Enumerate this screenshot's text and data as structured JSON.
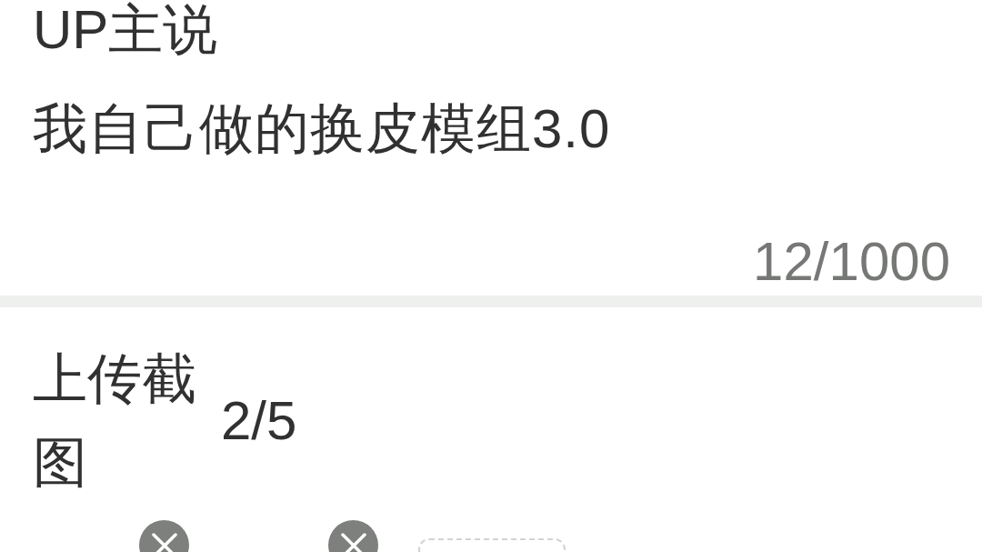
{
  "description_section": {
    "title": "UP主说",
    "value": "我自己做的换皮模组3.0",
    "counter": "12/1000"
  },
  "screenshots_section": {
    "label": "上传截图",
    "count": "2/5",
    "items": [
      {
        "kind": "screenshot"
      },
      {
        "kind": "screenshot"
      },
      {
        "kind": "add"
      }
    ]
  }
}
